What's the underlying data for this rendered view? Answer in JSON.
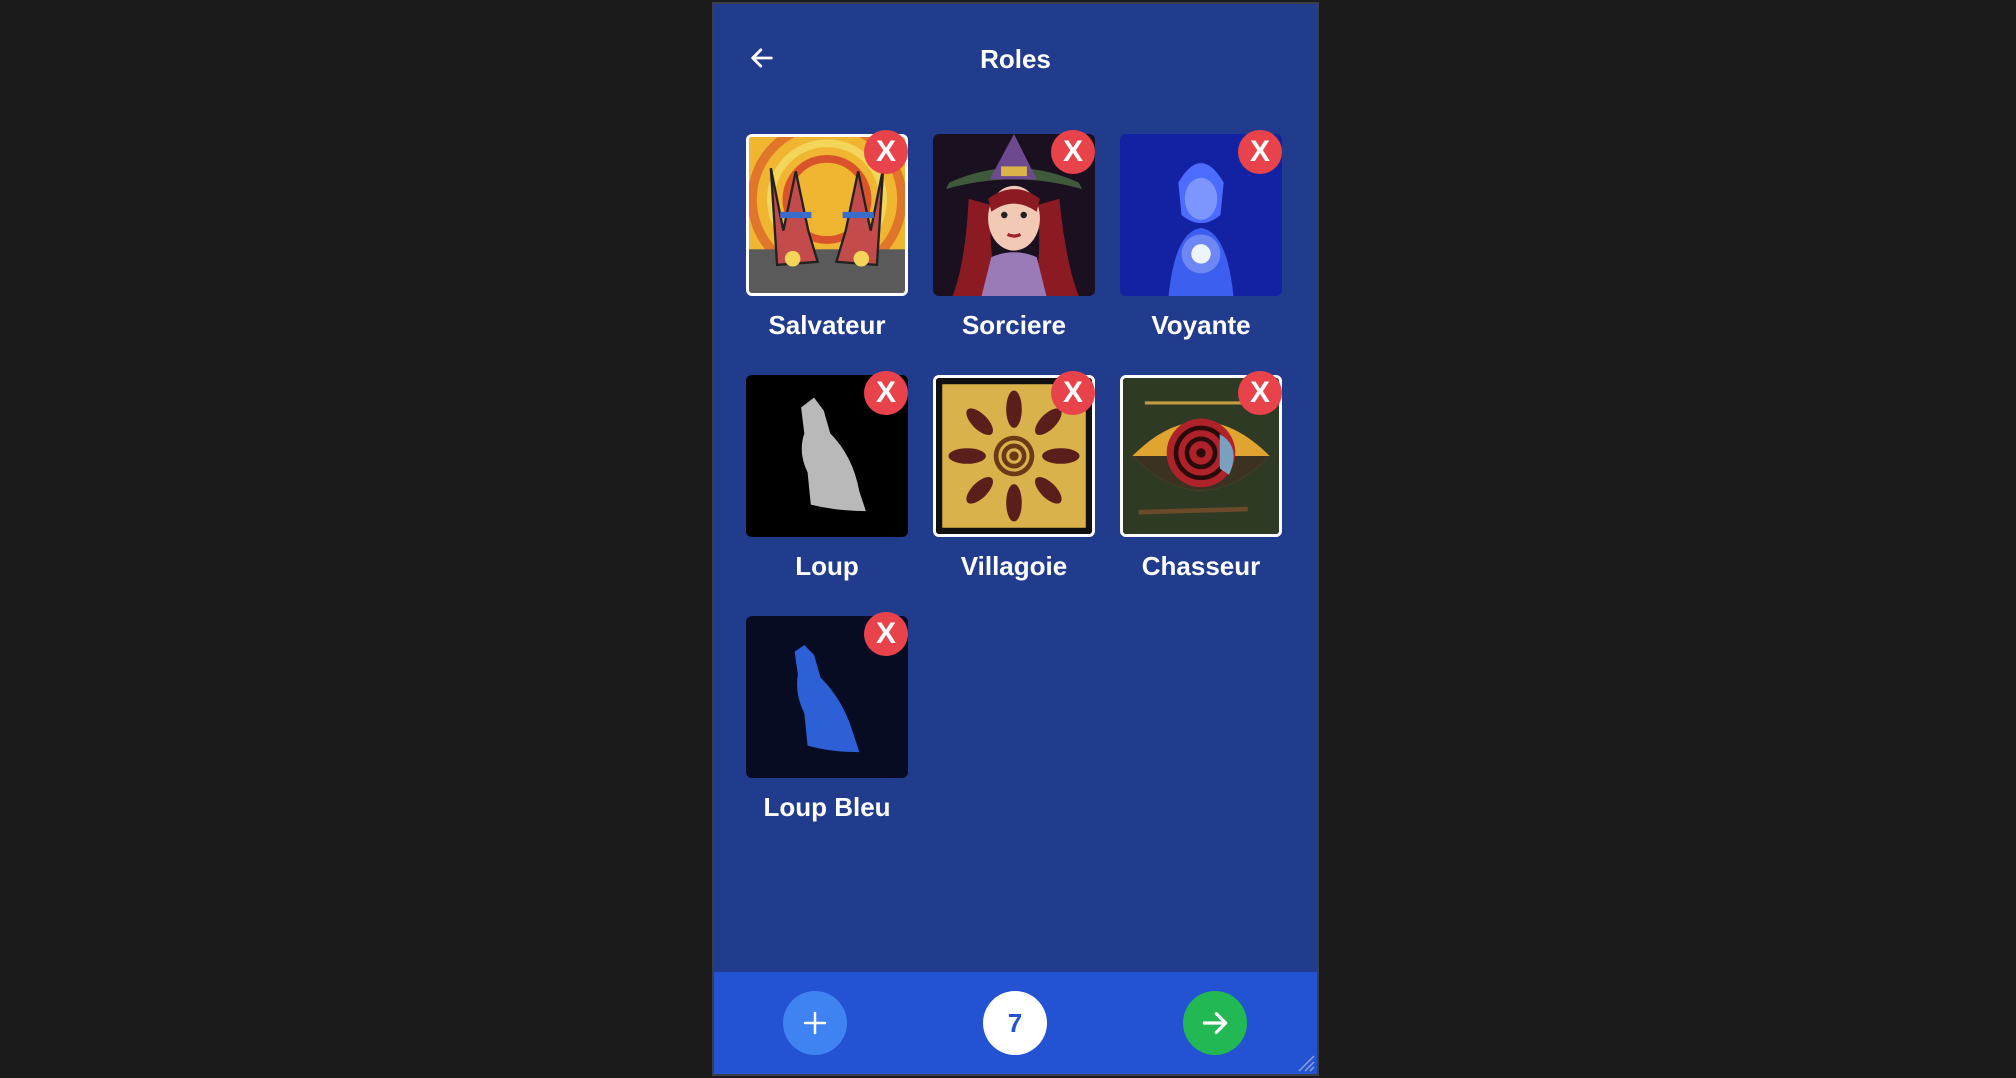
{
  "header": {
    "title": "Roles",
    "back_icon": "arrow-left-icon"
  },
  "roles": [
    {
      "name": "Salvateur",
      "remove_label": "X",
      "image": "salvateur-image"
    },
    {
      "name": "Sorciere",
      "remove_label": "X",
      "image": "sorciere-image"
    },
    {
      "name": "Voyante",
      "remove_label": "X",
      "image": "voyante-image"
    },
    {
      "name": "Loup",
      "remove_label": "X",
      "image": "loup-image"
    },
    {
      "name": "Villagoie",
      "remove_label": "X",
      "image": "villagoie-image"
    },
    {
      "name": "Chasseur",
      "remove_label": "X",
      "image": "chasseur-image"
    },
    {
      "name": "Loup Bleu",
      "remove_label": "X",
      "image": "loup-bleu-image"
    }
  ],
  "footer": {
    "add_icon": "plus-icon",
    "count": "7",
    "next_icon": "arrow-right-icon"
  },
  "colors": {
    "background": "#213b8d",
    "footer": "#2353d2",
    "remove": "#e8434a",
    "add": "#3f82f2",
    "next": "#22b954"
  }
}
